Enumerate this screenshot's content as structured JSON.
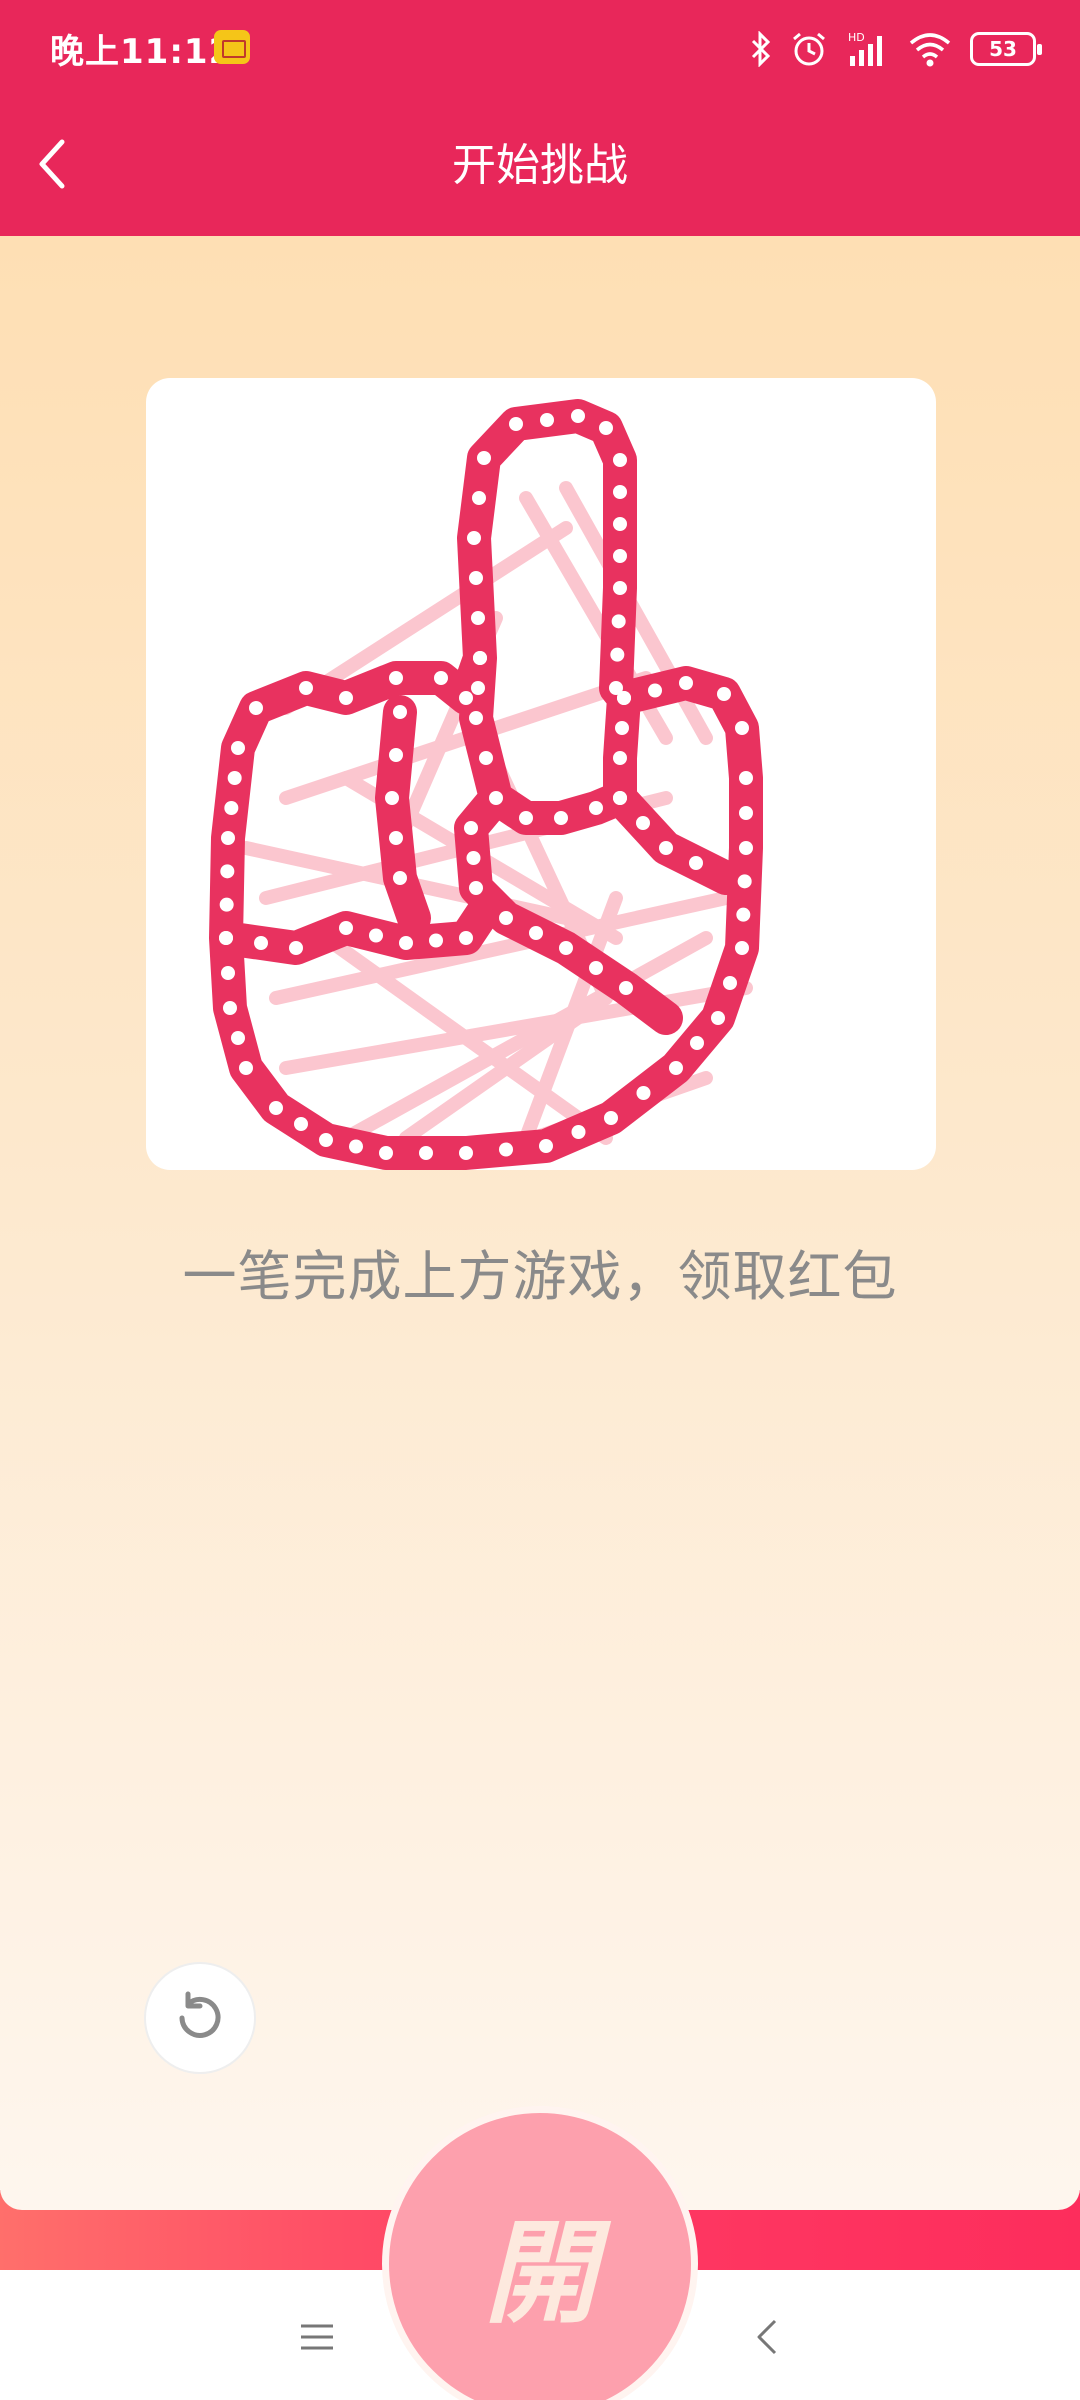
{
  "status_bar": {
    "time": "晚上11:12",
    "battery": "53",
    "icons": [
      "mail-icon",
      "bluetooth-icon",
      "alarm-icon",
      "signal-icon",
      "wifi-icon",
      "battery-icon"
    ]
  },
  "header": {
    "title": "开始挑战",
    "back_icon": "chevron-left-icon"
  },
  "puzzle": {
    "shape": "thumbs-up hand outline drawn with dotted path",
    "stroke_color": "#e8325f",
    "guide_color": "#fbc6cf"
  },
  "instruction": "一笔完成上方游戏，领取红包",
  "controls": {
    "reset_icon": "refresh-icon",
    "open_label": "開"
  },
  "colors": {
    "brand": "#e8275a",
    "background_top": "#fedfb4",
    "open_button": "#fda0ad"
  },
  "system_nav": [
    "menu-icon",
    "home-icon",
    "back-icon"
  ]
}
